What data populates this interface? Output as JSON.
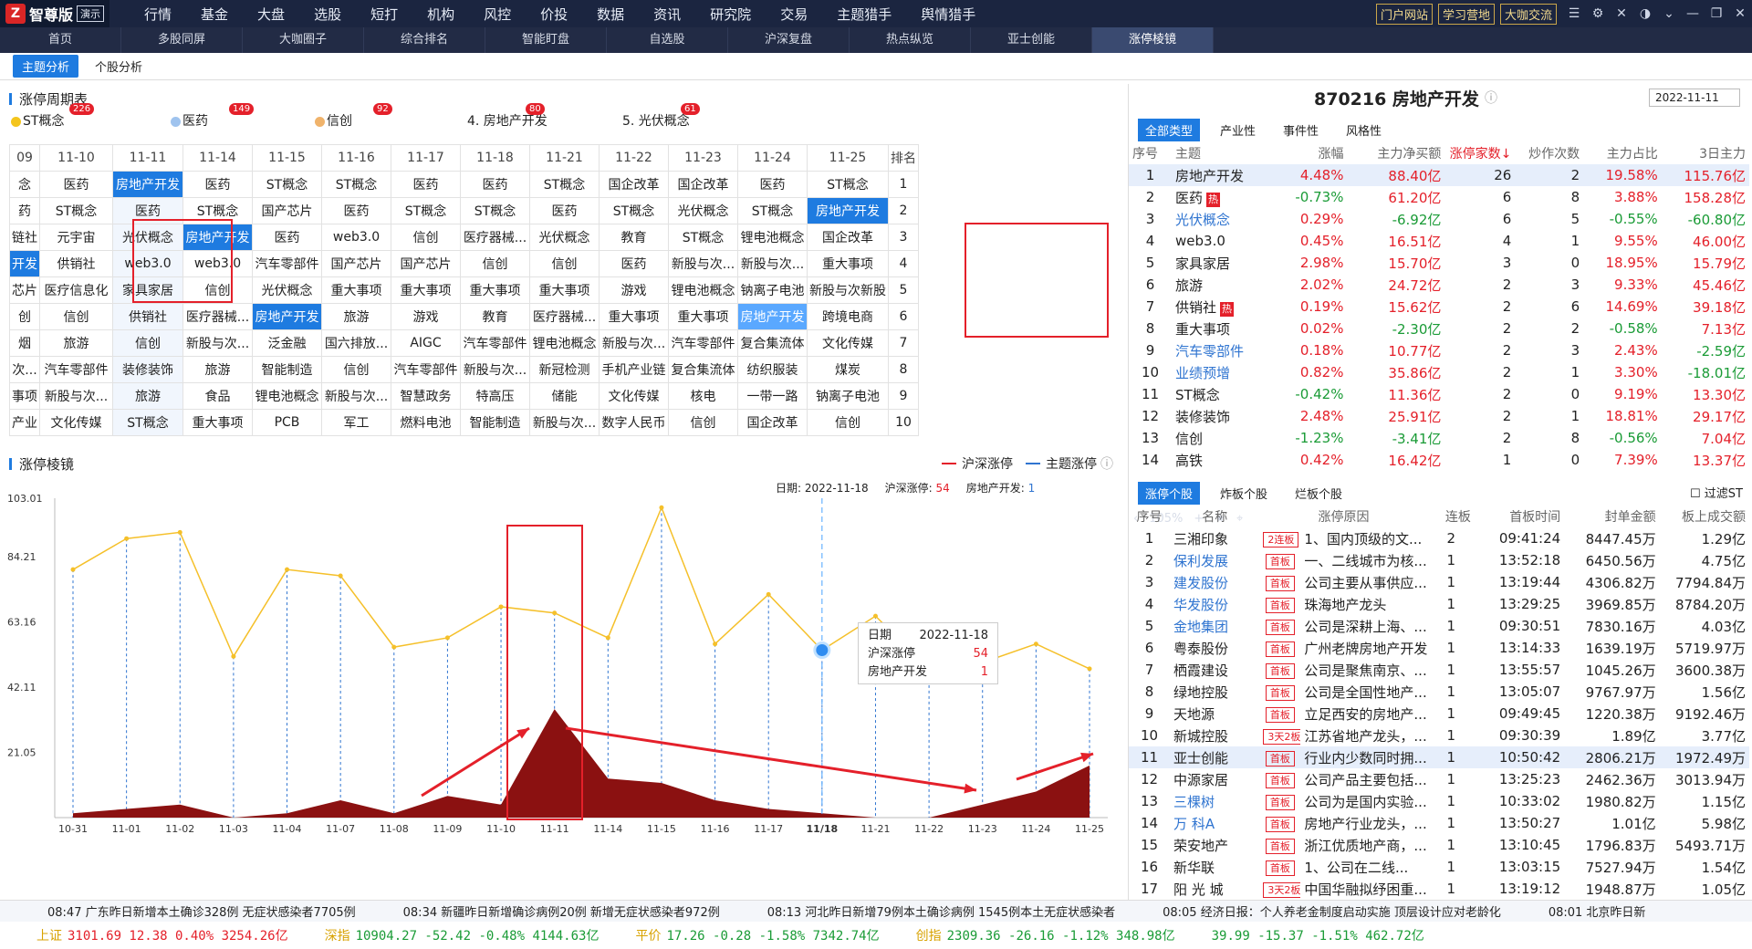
{
  "app": {
    "logo_mark": "Z",
    "name": "智尊版",
    "edition": "演示"
  },
  "menu": [
    "行情",
    "基金",
    "大盘",
    "选股",
    "短打",
    "机构",
    "风控",
    "价投",
    "数据",
    "资讯",
    "研究院",
    "交易",
    "主题猎手",
    "舆情猎手"
  ],
  "top_links": [
    "门户网站",
    "学习营地",
    "大咖交流"
  ],
  "tabs2": [
    "首页",
    "多股同屏",
    "大咖圈子",
    "综合排名",
    "智能盯盘",
    "自选股",
    "沪深复盘",
    "热点纵览",
    "亚士创能",
    "涨停棱镜"
  ],
  "tabs2_active": "涨停棱镜",
  "zoom": "105%",
  "sub_tabs": [
    "主题分析",
    "个股分析"
  ],
  "left": {
    "section1": "涨停周期表",
    "cats": [
      {
        "name": "ST概念",
        "count": "226",
        "color": "#f4c51d"
      },
      {
        "name": "医药",
        "count": "149",
        "color": "#9fc3ee"
      },
      {
        "name": "信创",
        "count": "92",
        "color": "#f0b36b"
      },
      {
        "name": "4. 房地产开发",
        "count": "80",
        "color": ""
      },
      {
        "name": "5. 光伏概念",
        "count": "61",
        "color": ""
      }
    ],
    "grid_header": [
      "09",
      "11-10",
      "11-11",
      "11-14",
      "11-15",
      "11-16",
      "11-17",
      "11-18",
      "11-21",
      "11-22",
      "11-23",
      "11-24",
      "11-25",
      "排名"
    ],
    "grid_rows": [
      [
        "念",
        "医药",
        "房地产开发",
        "医药",
        "ST概念",
        "ST概念",
        "医药",
        "医药",
        "ST概念",
        "国企改革",
        "国企改革",
        "医药",
        "ST概念",
        "1"
      ],
      [
        "药",
        "ST概念",
        "医药",
        "ST概念",
        "国产芯片",
        "医药",
        "ST概念",
        "ST概念",
        "医药",
        "ST概念",
        "光伏概念",
        "ST概念",
        "房地产开发",
        "2"
      ],
      [
        "链社",
        "元宇宙",
        "光伏概念",
        "房地产开发",
        "医药",
        "web3.0",
        "信创",
        "医疗器械...",
        "光伏概念",
        "教育",
        "ST概念",
        "锂电池概念",
        "国企改革",
        "3"
      ],
      [
        "开发",
        "供销社",
        "web3.0",
        "web3.0",
        "汽车零部件",
        "国产芯片",
        "国产芯片",
        "信创",
        "信创",
        "医药",
        "新股与次...",
        "新股与次...",
        "重大事项",
        "4"
      ],
      [
        "芯片",
        "医疗信息化",
        "家具家居",
        "信创",
        "光伏概念",
        "重大事项",
        "重大事项",
        "重大事项",
        "重大事项",
        "游戏",
        "锂电池概念",
        "钠离子电池",
        "新股与次新股",
        "5"
      ],
      [
        "创",
        "信创",
        "供销社",
        "医疗器械...",
        "房地产开发",
        "旅游",
        "游戏",
        "教育",
        "医疗器械...",
        "重大事项",
        "重大事项",
        "房地产开发",
        "跨境电商",
        "6"
      ],
      [
        "烟",
        "旅游",
        "信创",
        "新股与次...",
        "泛金融",
        "国六排放...",
        "AIGC",
        "汽车零部件",
        "锂电池概念",
        "新股与次...",
        "汽车零部件",
        "复合集流体",
        "文化传媒",
        "7"
      ],
      [
        "次...",
        "汽车零部件",
        "装修装饰",
        "旅游",
        "智能制造",
        "信创",
        "汽车零部件",
        "新股与次...",
        "新冠检测",
        "手机产业链",
        "复合集流体",
        "纺织服装",
        "煤炭",
        "8"
      ],
      [
        "事项",
        "新股与次...",
        "旅游",
        "食品",
        "锂电池概念",
        "新股与次...",
        "智慧政务",
        "特高压",
        "储能",
        "文化传媒",
        "核电",
        "一带一路",
        "钠离子电池",
        "9"
      ],
      [
        "产业",
        "文化传媒",
        "ST概念",
        "重大事项",
        "PCB",
        "军工",
        "燃料电池",
        "智能制造",
        "新股与次...",
        "数字人民币",
        "信创",
        "国企改革",
        "信创",
        "10"
      ]
    ],
    "highlights": [
      {
        "r": 0,
        "c": 2,
        "style": "blue"
      },
      {
        "r": 1,
        "c": 12,
        "style": "blue"
      },
      {
        "r": 2,
        "c": 3,
        "style": "blue"
      },
      {
        "r": 3,
        "c": 0,
        "style": "blue"
      },
      {
        "r": 5,
        "c": 4,
        "style": "blue"
      },
      {
        "r": 5,
        "c": 11,
        "style": "lblue"
      }
    ],
    "section2": "涨停棱镜",
    "legend": [
      "沪深涨停",
      "主题涨停"
    ],
    "info": {
      "date_label": "日期:",
      "date": "2022-11-18",
      "hs_label": "沪深涨停:",
      "hs": "54",
      "theme_label": "房地产开发:",
      "theme": "1"
    },
    "tooltip": {
      "date_label": "日期",
      "date": "2022-11-18",
      "hs_label": "沪深涨停",
      "hs": "54",
      "theme_label": "房地产开发",
      "theme": "1"
    }
  },
  "chart_data": {
    "type": "line",
    "x": [
      "10-31",
      "11-01",
      "11-02",
      "11-03",
      "11-04",
      "11-07",
      "11-08",
      "11-09",
      "11-10",
      "11-11",
      "11-14",
      "11-15",
      "11-16",
      "11-17",
      "11/18",
      "11-21",
      "11-22",
      "11-23",
      "11-24",
      "11-25"
    ],
    "series": [
      {
        "name": "沪深涨停",
        "color": "#f5c02a",
        "values": [
          80,
          90,
          92,
          52,
          80,
          78,
          55,
          58,
          68,
          66,
          58,
          100,
          56,
          72,
          54,
          65,
          48,
          50,
          56,
          48
        ]
      },
      {
        "name": "主题涨停",
        "color": "#8b1111",
        "values": [
          1,
          2,
          3,
          0,
          1,
          4,
          1,
          5,
          3,
          25,
          9,
          8,
          4,
          2,
          1,
          0,
          0,
          3,
          6,
          12
        ]
      }
    ],
    "yticks": [
      "103.01",
      "84.21",
      "63.16",
      "42.11",
      "21.05"
    ],
    "ylim": [
      0,
      103.01
    ],
    "highlight_x": "11/18",
    "grid": false,
    "marker_index": 14
  },
  "right": {
    "title": "870216 房地产开发",
    "date": "2022-11-11",
    "tabs": [
      "全部类型",
      "产业性",
      "事件性",
      "风格性"
    ],
    "head": [
      "序号",
      "主题",
      "涨幅",
      "主力净买额",
      "涨停家数↓",
      "炒作次数",
      "主力占比",
      "3日主力"
    ],
    "rows": [
      [
        "1",
        "房地产开发",
        "4.48%",
        "88.40亿",
        "26",
        "2",
        "19.58%",
        "115.76亿"
      ],
      [
        "2",
        "医药",
        "-0.73%",
        "61.20亿",
        "6",
        "8",
        "3.88%",
        "158.28亿"
      ],
      [
        "3",
        "光伏概念",
        "0.29%",
        "-6.92亿",
        "6",
        "5",
        "-0.55%",
        "-60.80亿"
      ],
      [
        "4",
        "web3.0",
        "0.45%",
        "16.51亿",
        "4",
        "1",
        "9.55%",
        "46.00亿"
      ],
      [
        "5",
        "家具家居",
        "2.98%",
        "15.70亿",
        "3",
        "0",
        "18.95%",
        "15.79亿"
      ],
      [
        "6",
        "旅游",
        "2.02%",
        "24.72亿",
        "2",
        "3",
        "9.33%",
        "45.46亿"
      ],
      [
        "7",
        "供销社",
        "0.19%",
        "15.62亿",
        "2",
        "6",
        "14.69%",
        "39.18亿"
      ],
      [
        "8",
        "重大事项",
        "0.02%",
        "-2.30亿",
        "2",
        "2",
        "-0.58%",
        "7.13亿"
      ],
      [
        "9",
        "汽车零部件",
        "0.18%",
        "10.77亿",
        "2",
        "3",
        "2.43%",
        "-2.59亿"
      ],
      [
        "10",
        "业绩预增",
        "0.82%",
        "35.86亿",
        "2",
        "1",
        "3.30%",
        "-18.01亿"
      ],
      [
        "11",
        "ST概念",
        "-0.42%",
        "11.36亿",
        "2",
        "0",
        "9.19%",
        "13.30亿"
      ],
      [
        "12",
        "装修装饰",
        "2.48%",
        "25.91亿",
        "2",
        "1",
        "18.81%",
        "29.17亿"
      ],
      [
        "13",
        "信创",
        "-1.23%",
        "-3.41亿",
        "2",
        "8",
        "-0.56%",
        "7.04亿"
      ],
      [
        "14",
        "高铁",
        "0.42%",
        "16.42亿",
        "1",
        "0",
        "7.39%",
        "13.37亿"
      ]
    ],
    "hot_label": "热",
    "tabs2": [
      "涨停个股",
      "炸板个股",
      "烂板个股"
    ],
    "filter_st": "过滤ST",
    "head2": [
      "序号",
      "名称",
      "涨停原因",
      "连板",
      "首板时间",
      "封单金额",
      "板上成交额"
    ],
    "stocks": [
      [
        "1",
        "三湘印象",
        "2连板",
        "1、国内顶级的文...",
        "2",
        "09:41:24",
        "8447.45万",
        "1.29亿"
      ],
      [
        "2",
        "保利发展",
        "首板",
        "一、二线城市为核...",
        "1",
        "13:52:18",
        "6450.56万",
        "4.75亿"
      ],
      [
        "3",
        "建发股份",
        "首板",
        "公司主要从事供应...",
        "1",
        "13:19:44",
        "4306.82万",
        "7794.84万"
      ],
      [
        "4",
        "华发股份",
        "首板",
        "珠海地产龙头",
        "1",
        "13:29:25",
        "3969.85万",
        "8784.20万"
      ],
      [
        "5",
        "金地集团",
        "首板",
        "公司是深耕上海、...",
        "1",
        "09:30:51",
        "7830.16万",
        "4.03亿"
      ],
      [
        "6",
        "粤泰股份",
        "首板",
        "广州老牌房地产开发商",
        "1",
        "13:14:33",
        "1639.19万",
        "5719.97万"
      ],
      [
        "7",
        "栖霞建设",
        "首板",
        "公司是聚焦南京、...",
        "1",
        "13:55:57",
        "1045.26万",
        "3600.38万"
      ],
      [
        "8",
        "绿地控股",
        "首板",
        "公司是全国性地产...",
        "1",
        "13:05:07",
        "9767.97万",
        "1.56亿"
      ],
      [
        "9",
        "天地源",
        "首板",
        "立足西安的房地产...",
        "1",
        "09:49:45",
        "1220.38万",
        "9192.46万"
      ],
      [
        "10",
        "新城控股",
        "3天2板",
        "江苏省地产龙头，...",
        "1",
        "09:30:39",
        "1.89亿",
        "3.77亿"
      ],
      [
        "11",
        "亚士创能",
        "首板",
        "行业内少数同时拥...",
        "1",
        "10:50:42",
        "2806.21万",
        "1972.49万"
      ],
      [
        "12",
        "中源家居",
        "首板",
        "公司产品主要包括...",
        "1",
        "13:25:23",
        "2462.36万",
        "3013.94万"
      ],
      [
        "13",
        "三棵树",
        "首板",
        "公司为是国内实验...",
        "1",
        "10:33:02",
        "1980.82万",
        "1.15亿"
      ],
      [
        "14",
        "万 科A",
        "首板",
        "房地产行业龙头，...",
        "1",
        "13:50:27",
        "1.01亿",
        "5.98亿"
      ],
      [
        "15",
        "荣安地产",
        "首板",
        "浙江优质地产商，...",
        "1",
        "13:10:45",
        "1796.83万",
        "5493.71万"
      ],
      [
        "16",
        "新华联",
        "首板",
        "1、公司在二线...",
        "1",
        "13:03:15",
        "7527.94万",
        "1.54亿"
      ],
      [
        "17",
        "阳 光 城",
        "3天2板",
        "中国华融拟纾困重...",
        "1",
        "13:19:12",
        "1948.87万",
        "1.05亿"
      ]
    ],
    "blue_names": [
      "保利发展",
      "建发股份",
      "华发股份",
      "金地集团",
      "三棵树",
      "万 科A"
    ],
    "blue_themes": [
      "光伏概念",
      "汽车零部件",
      "业绩预增"
    ],
    "hot_themes": [
      "医药",
      "供销社"
    ]
  },
  "news": [
    "08:47 广东昨日新增本土确诊328例 无症状感染者7705例",
    "08:34 新疆昨日新增确诊病例20例 新增无症状感染者972例",
    "08:13 河北昨日新增79例本土确诊病例 1545例本土无症状感染者",
    "08:05 经济日报：个人养老金制度启动实施 顶层设计应对老龄化",
    "08:01 北京昨日新"
  ],
  "quotes": [
    {
      "name": "上证",
      "text": "3101.69 12.38 0.40% 3254.26亿"
    },
    {
      "name": "深指",
      "text": "10904.27 -52.42 -0.48% 4144.63亿"
    },
    {
      "name": "平价",
      "text": "17.26 -0.28 -1.58% 7342.74亿"
    },
    {
      "name": "创指",
      "text": "2309.36 -26.16 -1.12% 348.98亿"
    },
    {
      "name": "",
      "text": "39.99 -15.37 -1.51% 462.72亿"
    }
  ]
}
